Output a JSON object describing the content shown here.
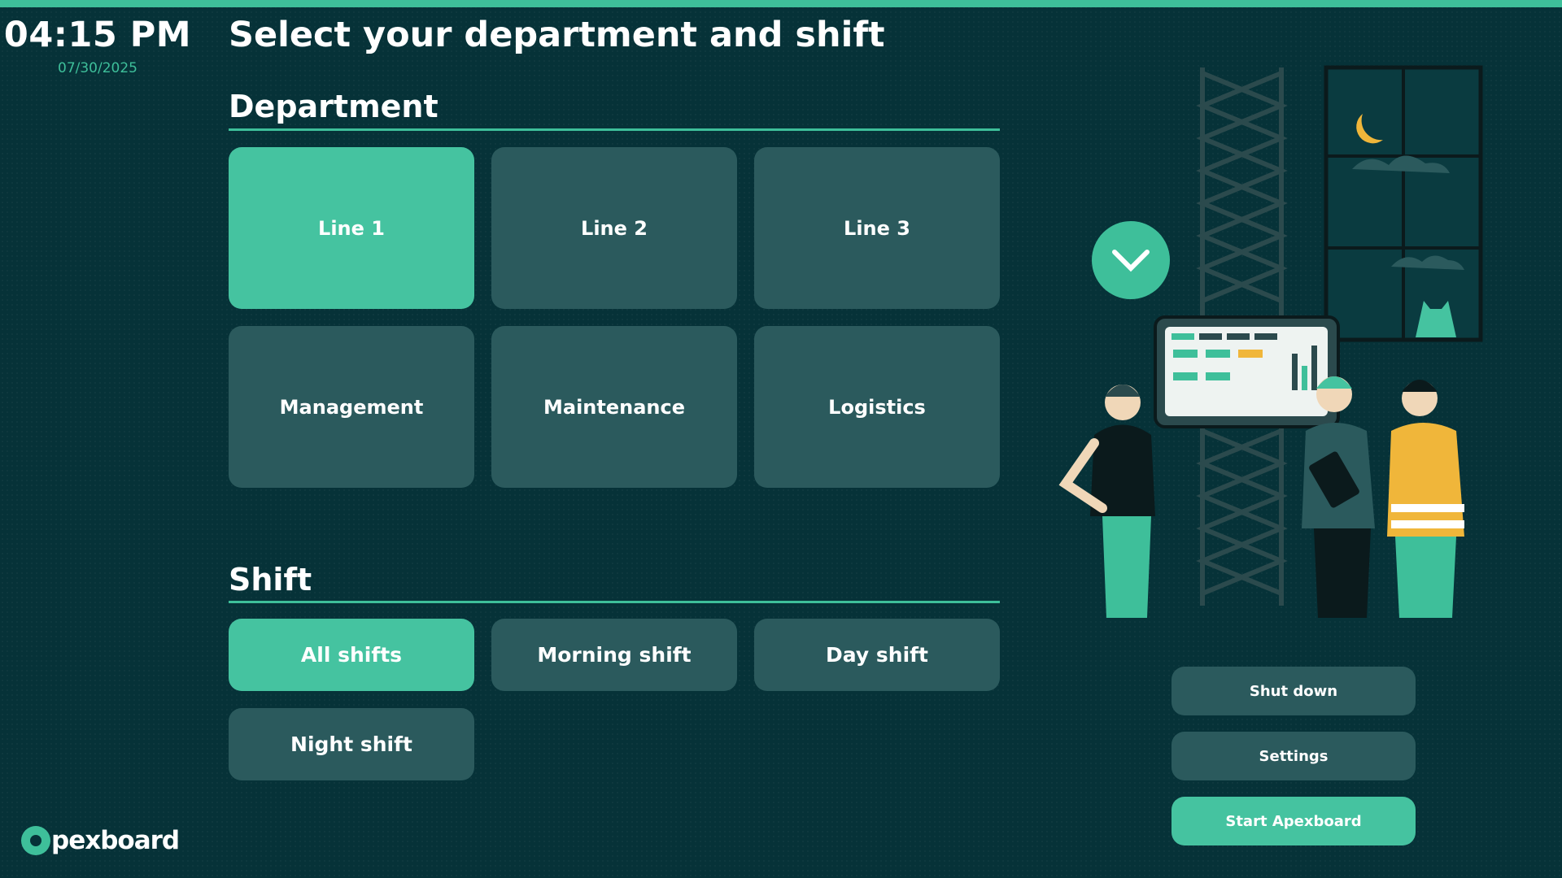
{
  "clock": {
    "time": "04:15 PM",
    "date": "07/30/2025"
  },
  "page": {
    "title": "Select your department and shift"
  },
  "department": {
    "heading": "Department",
    "options": [
      {
        "label": "Line 1",
        "selected": true
      },
      {
        "label": "Line 2",
        "selected": false
      },
      {
        "label": "Line 3",
        "selected": false
      },
      {
        "label": "Management",
        "selected": false
      },
      {
        "label": "Maintenance",
        "selected": false
      },
      {
        "label": "Logistics",
        "selected": false
      }
    ]
  },
  "shift": {
    "heading": "Shift",
    "options": [
      {
        "label": "All shifts",
        "selected": true
      },
      {
        "label": "Morning shift",
        "selected": false
      },
      {
        "label": "Day shift",
        "selected": false
      },
      {
        "label": "Night shift",
        "selected": false
      }
    ]
  },
  "actions": {
    "shutdown": "Shut down",
    "settings": "Settings",
    "start": "Start Apexboard"
  },
  "brand": {
    "logo_text": "pexboard"
  },
  "colors": {
    "background": "#063238",
    "accent": "#3ebf9a",
    "tile": "#2b5a5d",
    "tile_selected": "#45c3a0"
  },
  "icons": {
    "scroll_indicator": "chevron-down-icon",
    "logo": "apexboard-logo-icon"
  }
}
